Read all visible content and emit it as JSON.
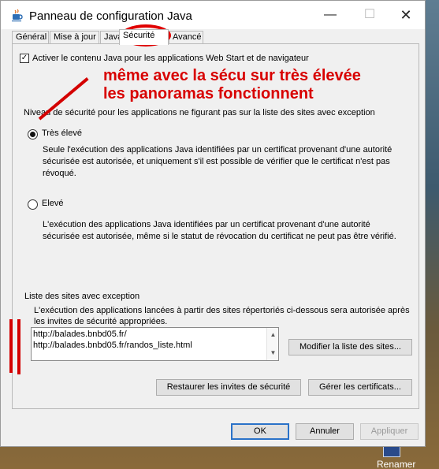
{
  "window": {
    "title": "Panneau de configuration Java",
    "minimize": "—",
    "maximize": "☐",
    "close": "✕"
  },
  "tabs": [
    {
      "label": "Général"
    },
    {
      "label": "Mise à jour"
    },
    {
      "label": "Java"
    },
    {
      "label": "Sécurité"
    },
    {
      "label": "Avancé"
    }
  ],
  "security": {
    "enable_label": "Activer le contenu Java pour les applications Web Start et de navigateur",
    "enable_checked": true,
    "level_heading": "Niveau de sécurité pour les applications ne figurant pas sur la liste des sites avec exception",
    "levels": [
      {
        "label": "Très élevé",
        "selected": true,
        "description": "Seule l'exécution des applications Java identifiées par un certificat provenant d'une autorité sécurisée est autorisée, et uniquement s'il est possible de vérifier que le certificat n'est pas révoqué."
      },
      {
        "label": "Elevé",
        "selected": false,
        "description": "L'exécution des applications Java identifiées par un certificat provenant d'une autorité sécurisée est autorisée, même si le statut de révocation du certificat ne peut pas être vérifié."
      }
    ],
    "exceptions": {
      "title": "Liste des sites avec exception",
      "description": "L'exécution des applications lancées à partir des sites répertoriés ci-dessous sera autorisée après les invites de sécurité appropriées.",
      "sites": [
        "http://balades.bnbd05.fr/",
        "http://balades.bnbd05.fr/randos_liste.html"
      ],
      "modify_button": "Modifier la liste des sites..."
    },
    "restore_button": "Restaurer les invites de sécurité",
    "certificates_button": "Gérer les certificats..."
  },
  "annotation": {
    "line1": "même avec la sécu sur très élevée",
    "line2": "les panoramas fonctionnent"
  },
  "footer": {
    "ok": "OK",
    "cancel": "Annuler",
    "apply": "Appliquer"
  },
  "desktop": {
    "icon_label": "Renamer"
  },
  "colors": {
    "annotation": "#d80000",
    "focus_border": "#2a72c8"
  }
}
